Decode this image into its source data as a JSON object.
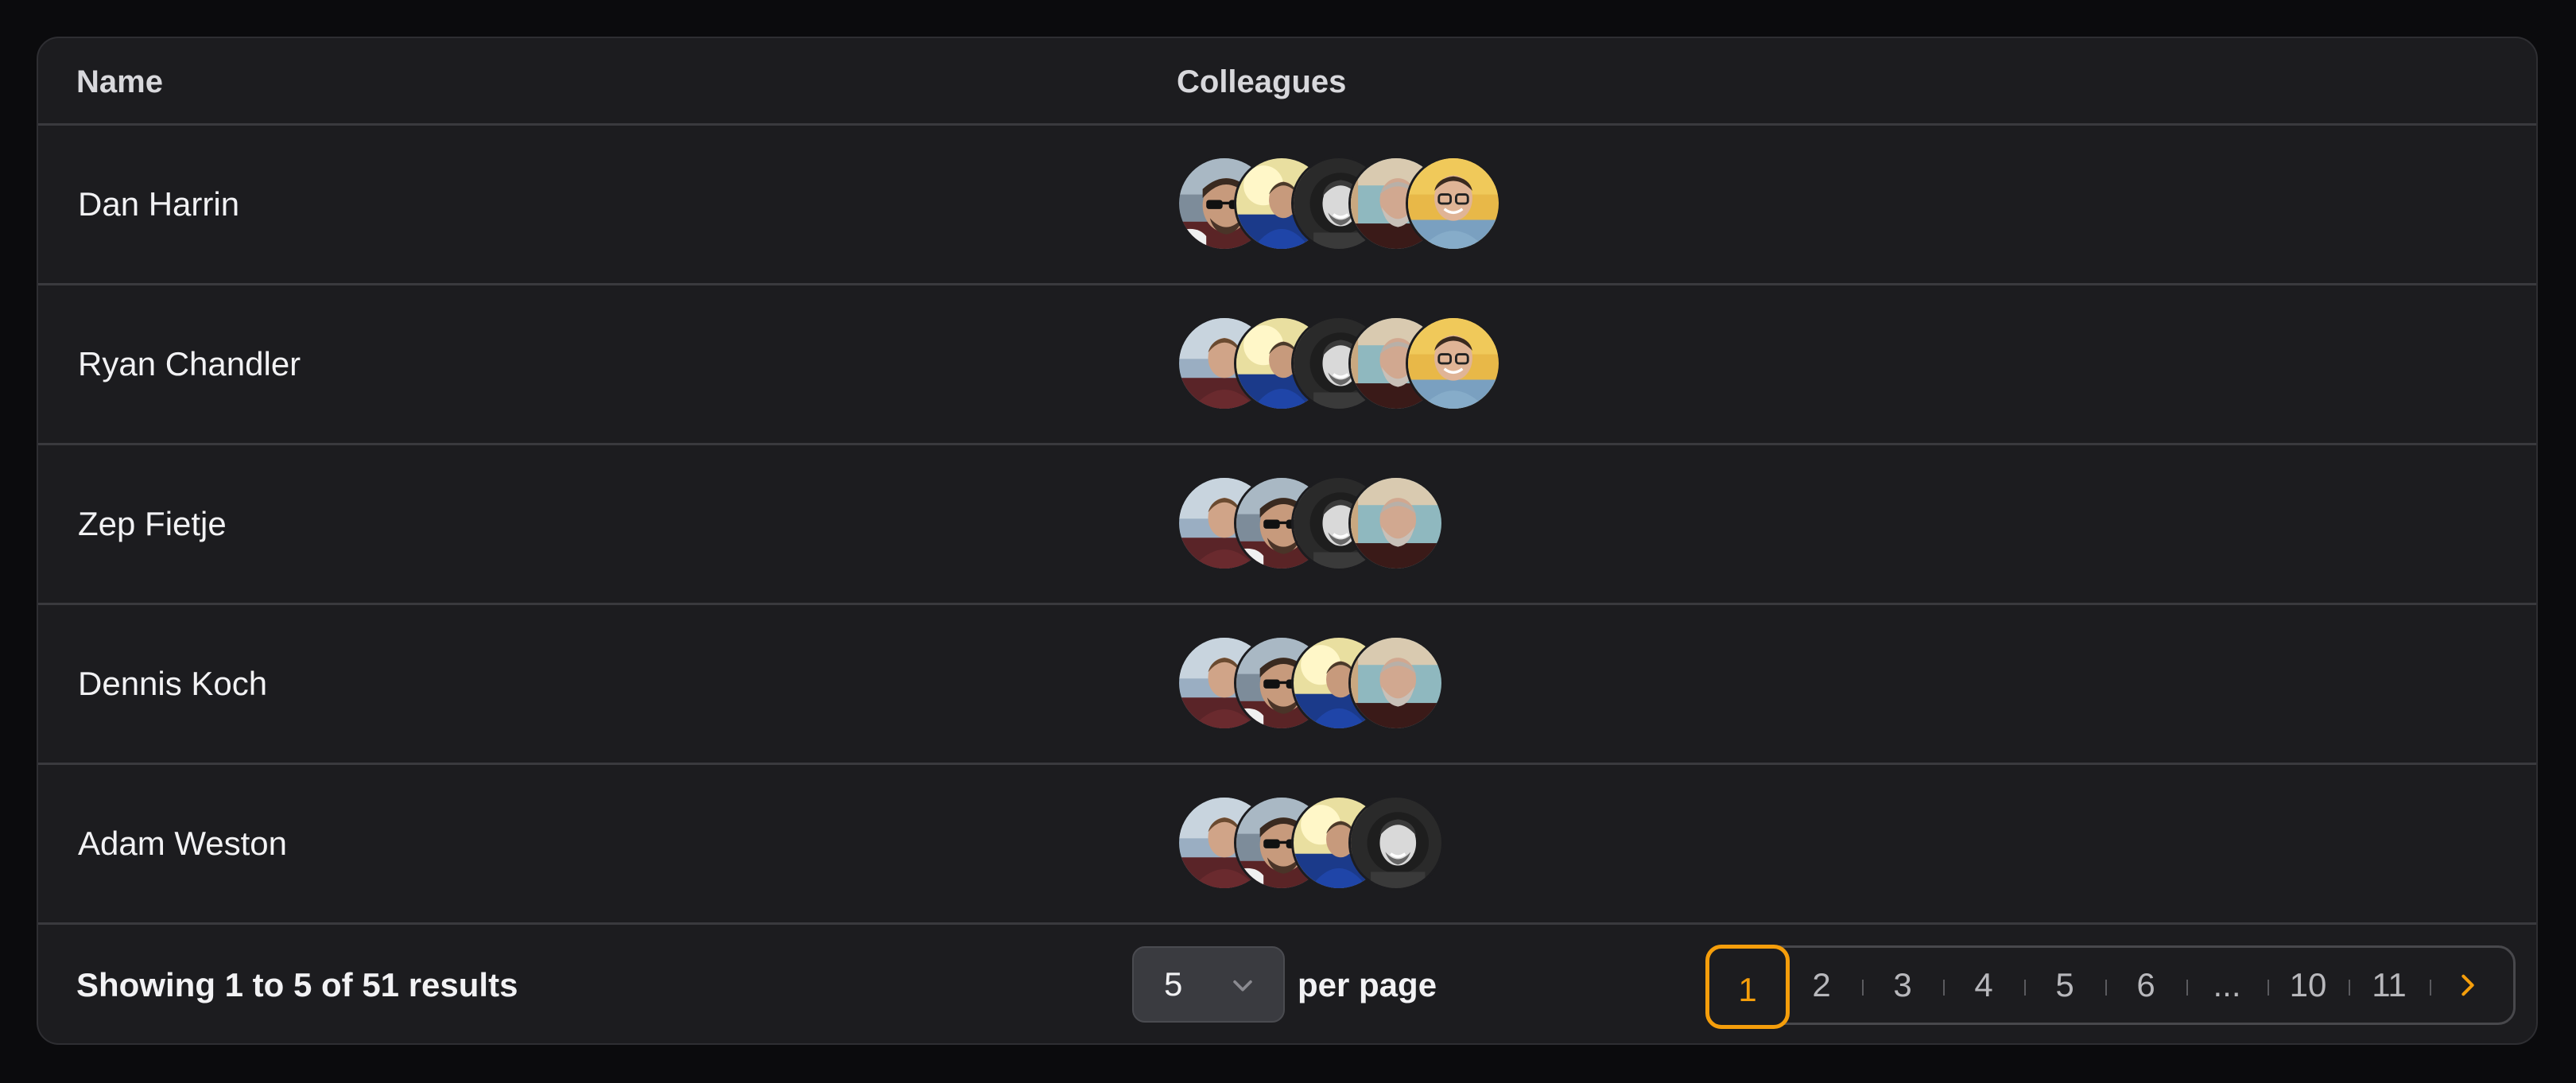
{
  "table": {
    "headers": {
      "name": "Name",
      "colleagues": "Colleagues"
    },
    "rows": [
      {
        "name": "Dan Harrin",
        "colleagues": [
          "sunglasses-man",
          "blue-shirt-man",
          "bw-smiling-man",
          "older-bearded-man",
          "glasses-man-yellow"
        ]
      },
      {
        "name": "Ryan Chandler",
        "colleagues": [
          "outdoor-man",
          "blue-shirt-man",
          "bw-smiling-man",
          "older-bearded-man",
          "glasses-man-yellow"
        ]
      },
      {
        "name": "Zep Fietje",
        "colleagues": [
          "outdoor-man",
          "sunglasses-man",
          "bw-smiling-man",
          "older-bearded-man"
        ]
      },
      {
        "name": "Dennis Koch",
        "colleagues": [
          "outdoor-man",
          "sunglasses-man",
          "blue-shirt-man",
          "older-bearded-man"
        ]
      },
      {
        "name": "Adam Weston",
        "colleagues": [
          "outdoor-man",
          "sunglasses-man",
          "blue-shirt-man",
          "bw-smiling-man"
        ]
      }
    ]
  },
  "footer": {
    "summary": "Showing 1 to 5 of 51 results",
    "per_page_value": "5",
    "per_page_label": "per page",
    "pages": [
      "1",
      "2",
      "3",
      "4",
      "5",
      "6",
      "...",
      "10",
      "11"
    ],
    "active_page": "1",
    "next_icon": "chevron-right-icon",
    "select_icon": "chevron-down-icon"
  },
  "colors": {
    "accent": "#f59e0b",
    "panel": "#1c1c1f",
    "background": "#0b0b0d"
  }
}
